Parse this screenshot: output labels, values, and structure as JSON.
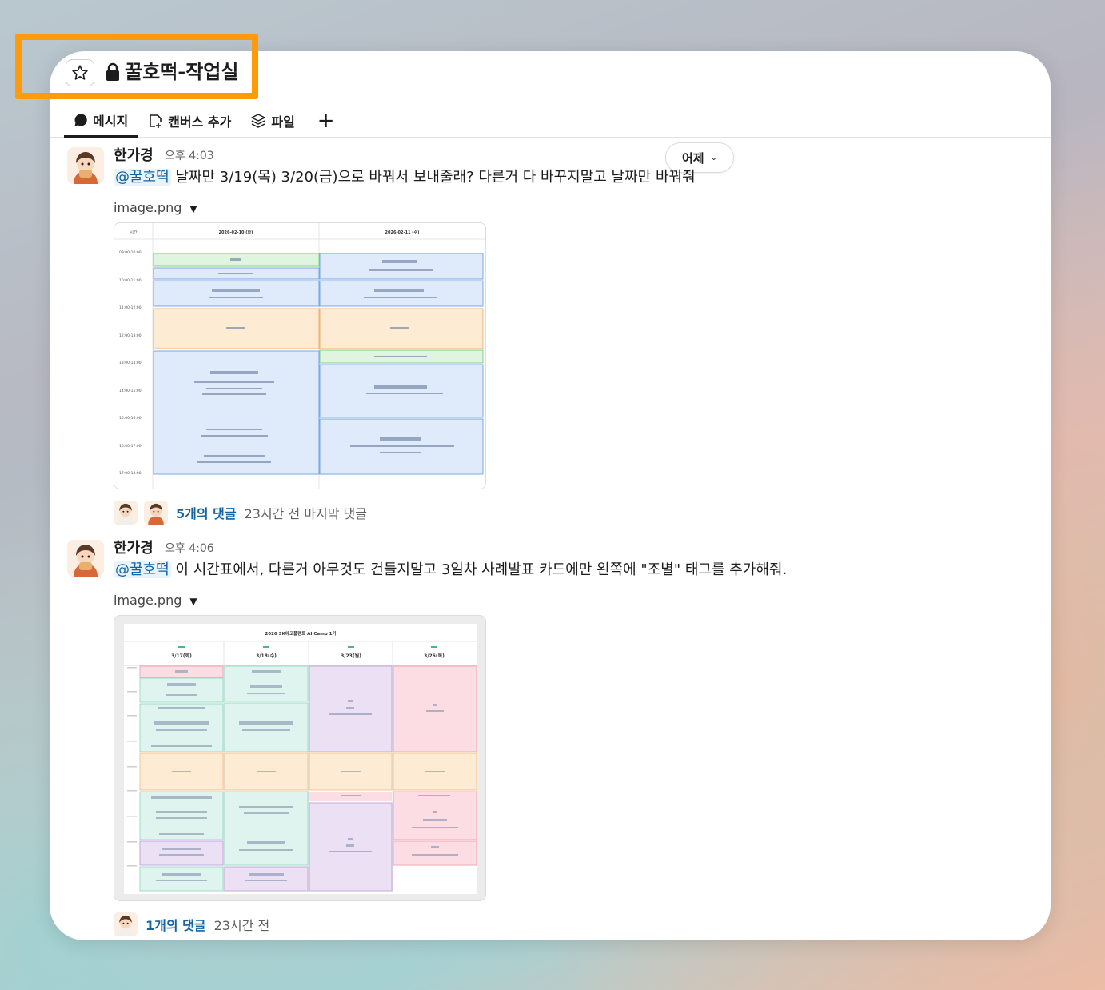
{
  "header": {
    "channel_name": "꿀호떡-작업실",
    "tabs": [
      {
        "label": "메시지"
      },
      {
        "label": "캔버스 추가"
      },
      {
        "label": "파일"
      },
      {
        "label": "+"
      }
    ]
  },
  "date_divider": {
    "label": "어제"
  },
  "messages": [
    {
      "author": "한가경",
      "time": "오후 4:03",
      "mention": "@꿀호떡",
      "text": " 날짜만 3/19(목) 3/20(금)으로 바꿔서 보내줄래? 다른거 다 바꾸지말고 날짜만 바꿔줘",
      "file_name": "image.png",
      "thumb_days": [
        "2026-02-10 (화)",
        "2026-02-11 (수)"
      ],
      "thumb_time_col": "시간",
      "thumb_times": [
        "09:00-10:00",
        "10:00-11:00",
        "11:00-12:00",
        "12:00-13:00",
        "13:00-14:00",
        "14:00-15:00",
        "15:00-16:00",
        "16:00-17:00",
        "17:00-18:00"
      ],
      "reply_count": "5개의 댓글",
      "reply_meta": "23시간 전 마지막 댓글"
    },
    {
      "author": "한가경",
      "time": "오후 4:06",
      "mention": "@꿀호떡",
      "text": " 이 시간표에서, 다른거 아무것도 건들지말고 3일차 사례발표 카드에만 왼쪽에 \"조별\" 태그를 추가해줘.",
      "file_name": "image.png",
      "thumb_title": "2026 SK에코플랜트 AI Camp 1기",
      "thumb_days": [
        "3/17(화)",
        "3/18(수)",
        "3/23(월)",
        "3/26(목)"
      ],
      "reply_count": "1개의 댓글",
      "reply_meta": "23시간 전"
    }
  ],
  "colors": {
    "highlight": "#ff9a0a",
    "link": "#1264a3",
    "mention_bg": "#e8f3fb"
  }
}
